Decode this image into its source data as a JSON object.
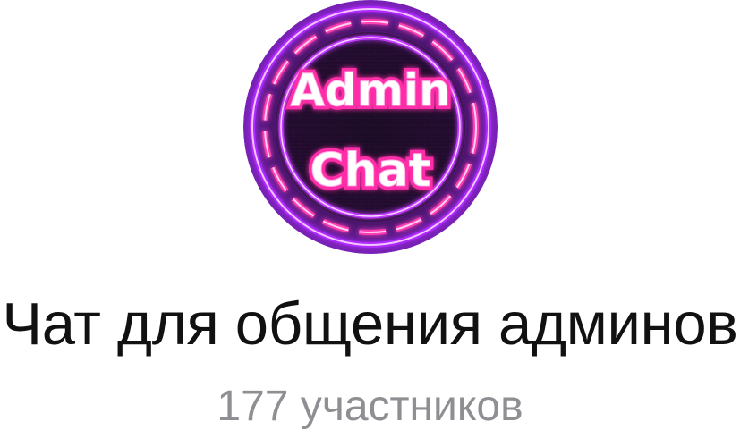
{
  "chat": {
    "avatar": {
      "icon": "admin-chat-neon-logo",
      "text_line1": "Admin",
      "text_line2": "Chat",
      "colors": {
        "ring_purple": "#a020f0",
        "ring_pink": "#ff3cb4",
        "inner_dark": "#1a0a22"
      }
    },
    "title": "Чат для общения админов",
    "members": "177 участников"
  }
}
